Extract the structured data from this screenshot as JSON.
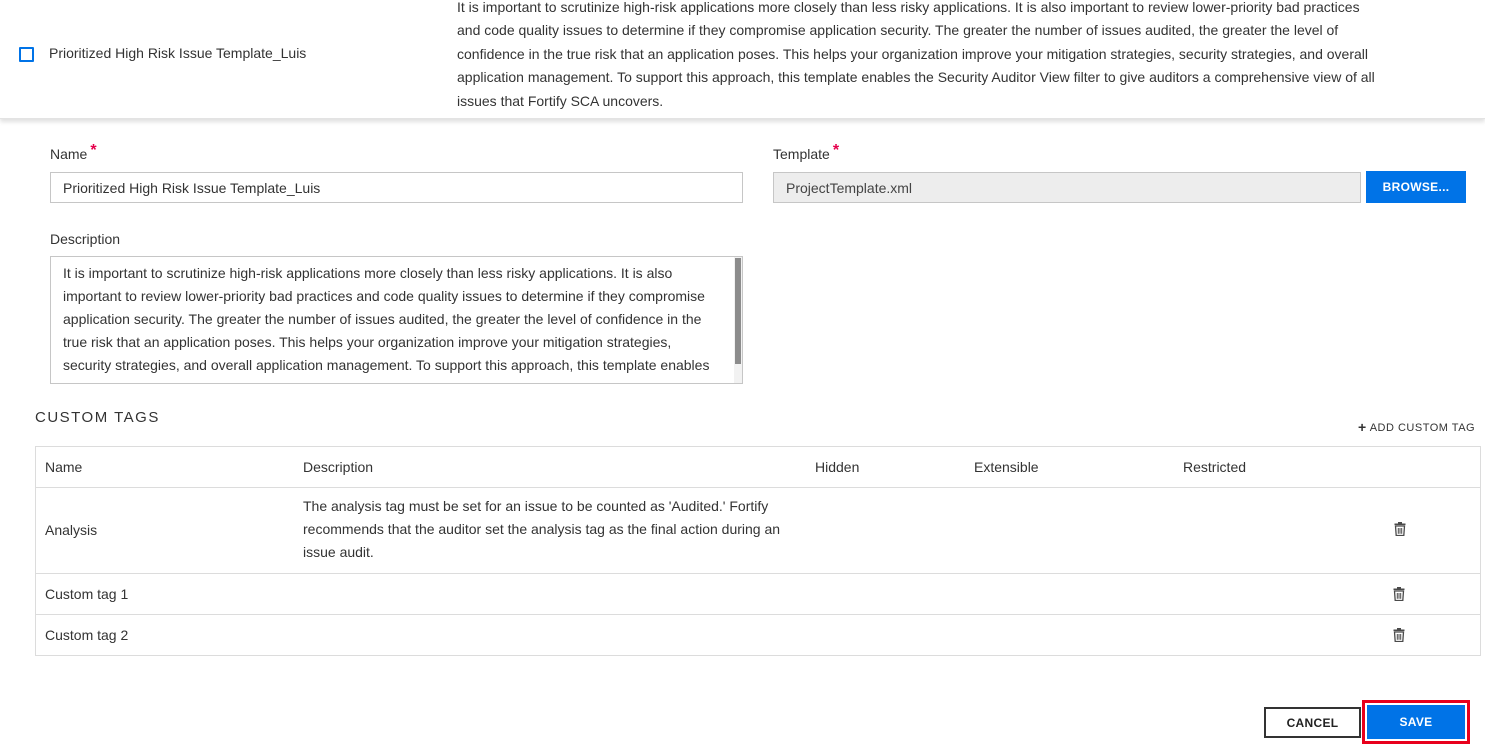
{
  "template_row": {
    "name": "Prioritized High Risk Issue Template_Luis",
    "description": "It is important to scrutinize high-risk applications more closely than less risky applications. It is also important to review lower-priority bad practices and code quality issues to determine if they compromise application security. The greater the number of issues audited, the greater the level of confidence in the true risk that an application poses. This helps your organization improve your mitigation strategies, security strategies, and overall application management. To support this approach, this template enables the Security Auditor View filter to give auditors a comprehensive view of all issues that Fortify SCA uncovers."
  },
  "form": {
    "name_label": "Name",
    "name_value": "Prioritized High Risk Issue Template_Luis",
    "template_label": "Template",
    "template_value": "ProjectTemplate.xml",
    "browse_label": "BROWSE...",
    "required_marker": "*",
    "description_label": "Description",
    "description_value": "It is important to scrutinize high-risk applications more closely than less risky applications. It is also important to review lower-priority bad practices and code quality issues to determine if they compromise application security. The greater the number of issues audited, the greater the level of confidence in the true risk that an application poses. This helps your organization improve your mitigation strategies, security strategies, and overall application management. To support this approach, this template enables the Security Auditor View filter to give auditors a comprehensive view of all issues that Fortify SCA uncovers."
  },
  "custom_tags": {
    "title": "CUSTOM TAGS",
    "add_label": "ADD CUSTOM TAG",
    "columns": {
      "name": "Name",
      "description": "Description",
      "hidden": "Hidden",
      "extensible": "Extensible",
      "restricted": "Restricted"
    },
    "rows": [
      {
        "name": "Analysis",
        "description": "The analysis tag must be set for an issue to be counted as 'Audited.' Fortify recommends that the auditor set the analysis tag as the final action during an issue audit."
      },
      {
        "name": "Custom tag 1",
        "description": ""
      },
      {
        "name": "Custom tag 2",
        "description": ""
      }
    ]
  },
  "footer": {
    "cancel_label": "CANCEL",
    "save_label": "SAVE"
  },
  "colors": {
    "primary": "#0073e7",
    "required": "#e5004c",
    "highlight": "#e8001c"
  },
  "icons": {
    "checkbox": "checkbox-unchecked-icon",
    "add": "plus-icon",
    "delete": "trash-icon"
  }
}
